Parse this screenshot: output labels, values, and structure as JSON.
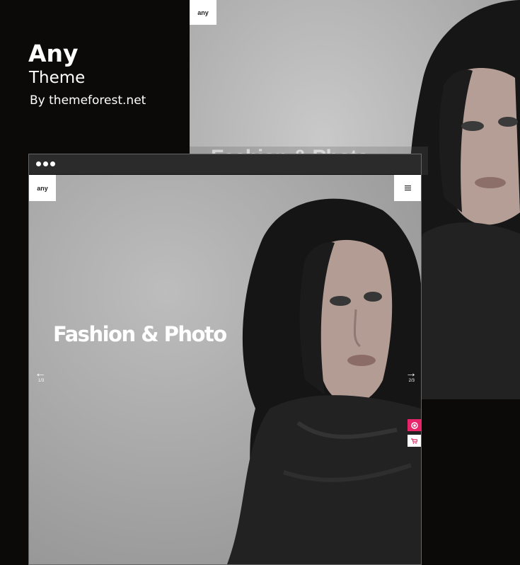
{
  "header": {
    "title": "Any",
    "subtitle": "Theme",
    "byline": "By themeforest.net"
  },
  "back_preview": {
    "logo": "any",
    "overlay_text": "Fashion & Photo"
  },
  "front_preview": {
    "logo": "any",
    "menu_icon": "hamburger-icon",
    "hero_text": "Fashion & Photo",
    "prev_counter": "1/3",
    "next_counter": "2/3",
    "side_icons": [
      "record-icon",
      "cart-icon"
    ]
  },
  "colors": {
    "background": "#0b0a08",
    "accent": "#e8246a"
  }
}
